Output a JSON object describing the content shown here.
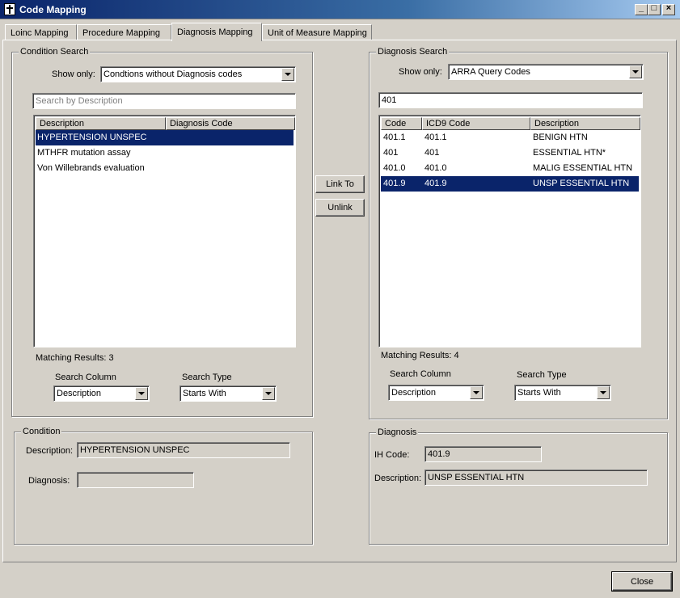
{
  "window": {
    "title": "Code Mapping",
    "minimize": "_",
    "maximize": "□",
    "close": "×"
  },
  "tabs": [
    "Loinc Mapping",
    "Procedure  Mapping",
    "Diagnosis Mapping",
    "Unit of Measure Mapping"
  ],
  "condition_search": {
    "title": "Condition Search",
    "show_only_label": "Show only:",
    "show_only_value": "Condtions without Diagnosis codes",
    "search_placeholder": "Search by Description",
    "columns": [
      "Description",
      "Diagnosis Code"
    ],
    "rows": [
      {
        "description": "HYPERTENSION UNSPEC",
        "diagnosis_code": ""
      },
      {
        "description": "MTHFR mutation assay",
        "diagnosis_code": ""
      },
      {
        "description": "Von Willebrands evaluation",
        "diagnosis_code": ""
      }
    ],
    "matching_results": "Matching Results: 3",
    "search_column_label": "Search Column",
    "search_column_value": "Description",
    "search_type_label": "Search Type",
    "search_type_value": "Starts With"
  },
  "buttons": {
    "link_to": "Link To",
    "unlink": "Unlink",
    "close": "Close"
  },
  "diagnosis_search": {
    "title": "Diagnosis Search",
    "show_only_label": "Show only:",
    "show_only_value": "ARRA Query Codes",
    "search_value": "401",
    "columns": [
      "Code",
      "ICD9 Code",
      "Description"
    ],
    "rows": [
      {
        "code": "401.1",
        "icd9": "401.1",
        "description": "BENIGN HTN"
      },
      {
        "code": "401",
        "icd9": "401",
        "description": "ESSENTIAL HTN*"
      },
      {
        "code": "401.0",
        "icd9": "401.0",
        "description": "MALIG ESSENTIAL HTN"
      },
      {
        "code": "401.9",
        "icd9": "401.9",
        "description": "UNSP ESSENTIAL HTN"
      }
    ],
    "matching_results": "Matching Results: 4",
    "search_column_label": "Search Column",
    "search_column_value": "Description",
    "search_type_label": "Search Type",
    "search_type_value": "Starts With"
  },
  "condition": {
    "title": "Condition",
    "description_label": "Description:",
    "description_value": "HYPERTENSION UNSPEC",
    "diagnosis_label": "Diagnosis:",
    "diagnosis_value": ""
  },
  "diagnosis": {
    "title": "Diagnosis",
    "ih_code_label": "IH Code:",
    "ih_code_value": "401.9",
    "description_label": "Description:",
    "description_value": "UNSP ESSENTIAL HTN"
  }
}
